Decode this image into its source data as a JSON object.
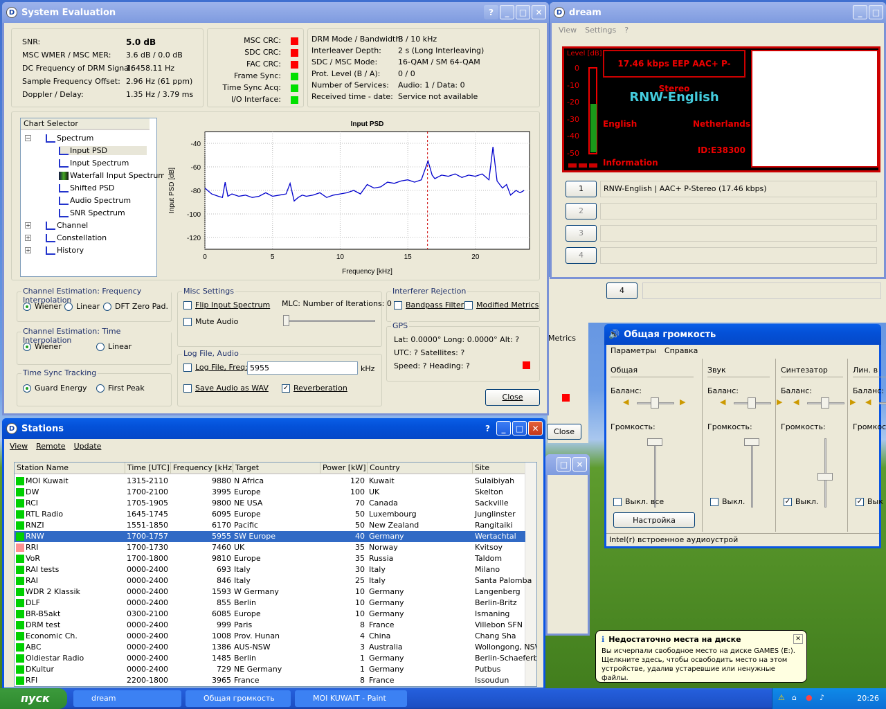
{
  "syseval": {
    "title": "System Evaluation",
    "metrics": [
      {
        "label": "SNR:",
        "value": "5.0 dB"
      },
      {
        "label": "MSC WMER / MSC MER:",
        "value": "3.6 dB / 0.0 dB"
      },
      {
        "label": "DC Frequency of DRM Signal:",
        "value": "16458.11 Hz"
      },
      {
        "label": "Sample Frequency Offset:",
        "value": "2.96 Hz (61 ppm)"
      },
      {
        "label": "Doppler / Delay:",
        "value": "1.35 Hz / 3.79 ms"
      }
    ],
    "status": [
      {
        "label": "MSC CRC:",
        "color": "#ff0000"
      },
      {
        "label": "SDC CRC:",
        "color": "#ff0000"
      },
      {
        "label": "FAC CRC:",
        "color": "#ff0000"
      },
      {
        "label": "Frame Sync:",
        "color": "#00e000"
      },
      {
        "label": "Time Sync Acq:",
        "color": "#00e000"
      },
      {
        "label": "I/O Interface:",
        "color": "#00e000"
      }
    ],
    "drm": [
      {
        "label": "DRM Mode / Bandwidth:",
        "value": "B / 10 kHz"
      },
      {
        "label": "Interleaver Depth:",
        "value": "2 s (Long Interleaving)"
      },
      {
        "label": "SDC / MSC Mode:",
        "value": "16-QAM / SM 64-QAM"
      },
      {
        "label": "Prot. Level (B / A):",
        "value": "0 / 0"
      },
      {
        "label": "Number of Services:",
        "value": "Audio: 1 / Data: 0"
      },
      {
        "label": "Received time - date:",
        "value": "Service not available"
      }
    ],
    "chart_selector": {
      "header": "Chart Selector",
      "items": [
        "Spectrum",
        "Input PSD",
        "Input Spectrum",
        "Waterfall Input Spectrum",
        "Shifted PSD",
        "Audio Spectrum",
        "SNR Spectrum",
        "Channel",
        "Constellation",
        "History"
      ]
    },
    "freq_interp": {
      "title": "Channel Estimation: Frequency Interpolation",
      "options": [
        "Wiener",
        "Linear",
        "DFT Zero Pad."
      ]
    },
    "time_interp": {
      "title": "Channel Estimation: Time Interpolation",
      "options": [
        "Wiener",
        "Linear"
      ]
    },
    "time_sync": {
      "title": "Time Sync Tracking",
      "options": [
        "Guard Energy",
        "First Peak"
      ]
    },
    "misc": {
      "title": "Misc Settings",
      "flip": "Flip Input Spectrum",
      "mute": "Mute Audio",
      "mlc": "MLC: Number of Iterations: 0"
    },
    "logfile": {
      "title": "Log File, Audio",
      "logfreq": "Log File, Freq:",
      "freq_value": "5955",
      "unit": "kHz",
      "save": "Save Audio as WAV",
      "reverb": "Reverberation"
    },
    "interferer": {
      "title": "Interferer Rejection",
      "bandpass": "Bandpass Filter",
      "modified": "Modified Metrics"
    },
    "gps": {
      "title": "GPS",
      "line1": "Lat: 0.0000°  Long: 0.0000°  Alt: ?",
      "line2": "UTC: ?  Satellites: ?",
      "line3": "Speed: ?  Heading: ?"
    },
    "close": "Close"
  },
  "chart_data": {
    "type": "line",
    "title": "Input PSD",
    "xlabel": "Frequency [kHz]",
    "ylabel": "Input PSD [dB]",
    "xlim": [
      0,
      24
    ],
    "ylim": [
      -130,
      -30
    ],
    "xticks": [
      "0",
      "5",
      "10",
      "15",
      "20"
    ],
    "yticks": [
      "-40",
      "-60",
      "-80",
      "-100",
      "-120"
    ],
    "marker_x": 16.46,
    "line_color": "#0000cc",
    "x": [
      0,
      0.5,
      1,
      1.3,
      1.5,
      1.7,
      2,
      2.5,
      3,
      3.5,
      4,
      4.5,
      5,
      5.5,
      6,
      6.3,
      6.6,
      6.9,
      7.2,
      7.5,
      8,
      8.5,
      9,
      9.5,
      10,
      10.5,
      11,
      11.5,
      12,
      12.5,
      13,
      13.5,
      14,
      14.5,
      15,
      15.5,
      16,
      16.5,
      16.8,
      17,
      17.5,
      18,
      18.5,
      19,
      19.5,
      20,
      20.5,
      21,
      21.3,
      21.6,
      22,
      22.3,
      22.6,
      23,
      23.3,
      23.6
    ],
    "y": [
      -78,
      -83,
      -85,
      -86,
      -73,
      -85,
      -83,
      -85,
      -84,
      -86,
      -85,
      -82,
      -85,
      -84,
      -83,
      -74,
      -89,
      -86,
      -84,
      -85,
      -84,
      -82,
      -86,
      -84,
      -83,
      -82,
      -80,
      -83,
      -75,
      -78,
      -77,
      -73,
      -74,
      -72,
      -71,
      -73,
      -71,
      -55,
      -67,
      -70,
      -67,
      -68,
      -66,
      -69,
      -67,
      -68,
      -66,
      -71,
      -43,
      -72,
      -78,
      -75,
      -84,
      -80,
      -82,
      -80
    ]
  },
  "dream": {
    "title": "dream",
    "menu": [
      "View",
      "Settings",
      "?"
    ],
    "level_label": "Level [dB]",
    "level_ticks": [
      "0",
      "-10",
      "-20",
      "-30",
      "-40",
      "-50"
    ],
    "level_value": -25,
    "bitrate": "17.46 kbps EEP  AAC+  P-Stereo",
    "station": "RNW-English",
    "language": "English",
    "country": "Netherlands",
    "info": "Information",
    "id": "ID:E38300",
    "services": [
      {
        "num": "1",
        "text": "RNW-English  |  AAC+ P-Stereo (17.46 kbps)"
      },
      {
        "num": "2",
        "text": ""
      },
      {
        "num": "3",
        "text": ""
      },
      {
        "num": "4",
        "text": ""
      }
    ]
  },
  "bgwin": {
    "num4": "4",
    "metrics_text": "Metrics",
    "close_text": "Close"
  },
  "stations": {
    "title": "Stations",
    "menu": [
      "View",
      "Remote",
      "Update"
    ],
    "columns": [
      "Station Name",
      "Time [UTC]",
      "Frequency [kHz]",
      "Target",
      "Power [kW]",
      "Country",
      "Site"
    ],
    "rows": [
      {
        "c": "#00d000",
        "name": "MOI Kuwait",
        "time": "1315-2110",
        "freq": "9880",
        "target": "N Africa",
        "power": "120",
        "country": "Kuwait",
        "site": "Sulaibiyah"
      },
      {
        "c": "#00d000",
        "name": "DW",
        "time": "1700-2100",
        "freq": "3995",
        "target": "Europe",
        "power": "100",
        "country": "UK",
        "site": "Skelton"
      },
      {
        "c": "#00d000",
        "name": "RCI",
        "time": "1705-1905",
        "freq": "9800",
        "target": "NE USA",
        "power": "70",
        "country": "Canada",
        "site": "Sackville"
      },
      {
        "c": "#00d000",
        "name": "RTL Radio",
        "time": "1645-1745",
        "freq": "6095",
        "target": "Europe",
        "power": "50",
        "country": "Luxembourg",
        "site": "Junglinster"
      },
      {
        "c": "#00d000",
        "name": "RNZI",
        "time": "1551-1850",
        "freq": "6170",
        "target": "Pacific",
        "power": "50",
        "country": "New Zealand",
        "site": "Rangitaiki"
      },
      {
        "c": "#00d000",
        "name": "RNW",
        "time": "1700-1757",
        "freq": "5955",
        "target": "SW Europe",
        "power": "40",
        "country": "Germany",
        "site": "Wertachtal",
        "sel": true
      },
      {
        "c": "#ff9090",
        "name": "RRI",
        "time": "1700-1730",
        "freq": "7460",
        "target": "UK",
        "power": "35",
        "country": "Norway",
        "site": "Kvitsoy"
      },
      {
        "c": "#00d000",
        "name": "VoR",
        "time": "1700-1800",
        "freq": "9810",
        "target": "Europe",
        "power": "35",
        "country": "Russia",
        "site": "Taldom"
      },
      {
        "c": "#00d000",
        "name": "RAI tests",
        "time": "0000-2400",
        "freq": "693",
        "target": "Italy",
        "power": "30",
        "country": "Italy",
        "site": "Milano"
      },
      {
        "c": "#00d000",
        "name": "RAI",
        "time": "0000-2400",
        "freq": "846",
        "target": "Italy",
        "power": "25",
        "country": "Italy",
        "site": "Santa Palomba"
      },
      {
        "c": "#00d000",
        "name": "WDR 2 Klassik",
        "time": "0000-2400",
        "freq": "1593",
        "target": "W Germany",
        "power": "10",
        "country": "Germany",
        "site": "Langenberg"
      },
      {
        "c": "#00d000",
        "name": "DLF",
        "time": "0000-2400",
        "freq": "855",
        "target": "Berlin",
        "power": "10",
        "country": "Germany",
        "site": "Berlin-Britz"
      },
      {
        "c": "#00d000",
        "name": "BR-B5akt",
        "time": "0300-2100",
        "freq": "6085",
        "target": "Europe",
        "power": "10",
        "country": "Germany",
        "site": "Ismaning"
      },
      {
        "c": "#00d000",
        "name": "DRM test",
        "time": "0000-2400",
        "freq": "999",
        "target": "Paris",
        "power": "8",
        "country": "France",
        "site": "Villebon SFN"
      },
      {
        "c": "#00d000",
        "name": "Economic Ch.",
        "time": "0000-2400",
        "freq": "1008",
        "target": "Prov. Hunan",
        "power": "4",
        "country": "China",
        "site": "Chang Sha"
      },
      {
        "c": "#00d000",
        "name": "ABC",
        "time": "0000-2400",
        "freq": "1386",
        "target": "AUS-NSW",
        "power": "3",
        "country": "Australia",
        "site": "Wollongong, NSW"
      },
      {
        "c": "#00d000",
        "name": "Oldiestar Radio",
        "time": "0000-2400",
        "freq": "1485",
        "target": "Berlin",
        "power": "1",
        "country": "Germany",
        "site": "Berlin-Schaeferberg"
      },
      {
        "c": "#00d000",
        "name": "DKultur",
        "time": "0000-2400",
        "freq": "729",
        "target": "NE Germany",
        "power": "1",
        "country": "Germany",
        "site": "Putbus"
      },
      {
        "c": "#00d000",
        "name": "RFI",
        "time": "2200-1800",
        "freq": "3965",
        "target": "France",
        "power": "8",
        "country": "France",
        "site": "Issoudun"
      }
    ]
  },
  "volume": {
    "title": "Общая громкость",
    "menu": [
      "Параметры",
      "Справка"
    ],
    "balance": "Баланс:",
    "volume": "Громкость:",
    "channels": [
      {
        "name": "Общая",
        "mute": "Выкл. все",
        "checked": false,
        "pos": 0.0
      },
      {
        "name": "Звук",
        "mute": "Выкл.",
        "checked": false,
        "pos": 0.0
      },
      {
        "name": "Синтезатор",
        "mute": "Выкл.",
        "checked": true,
        "pos": 0.55
      },
      {
        "name": "Лин. в",
        "mute": "Вык",
        "checked": true,
        "pos": 0.0
      }
    ],
    "settings_btn": "Настройка",
    "device": "Intel(r) встроенное аудиоустрой"
  },
  "balloon": {
    "title": "Недостаточно места на диске",
    "text": "Вы исчерпали свободное место на диске GAMES (E:). Щелкните здесь, чтобы освободить место на этом устройстве, удалив устаревшие или ненужные файлы."
  },
  "taskbar": {
    "start": "пуск",
    "tasks": [
      "dream",
      "Общая громкость",
      "MOI KUWAIT - Paint"
    ],
    "clock": "20:26"
  }
}
